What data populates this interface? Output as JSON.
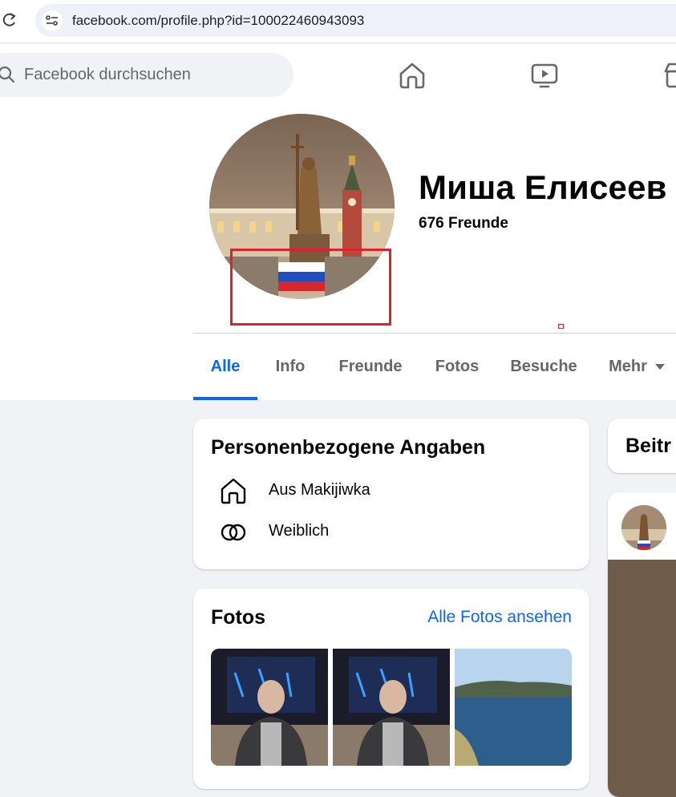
{
  "browser": {
    "url": "facebook.com/profile.php?id=100022460943093"
  },
  "nav": {
    "search_placeholder": "Facebook durchsuchen",
    "icons": [
      "home-icon",
      "watch-icon",
      "marketplace-icon"
    ]
  },
  "profile": {
    "name": "Миша Елисеев",
    "friends": "676 Freunde",
    "tabs": [
      {
        "label": "Alle",
        "active": true
      },
      {
        "label": "Info",
        "active": false
      },
      {
        "label": "Freunde",
        "active": false
      },
      {
        "label": "Fotos",
        "active": false
      },
      {
        "label": "Besuche",
        "active": false
      },
      {
        "label": "Mehr",
        "active": false
      }
    ]
  },
  "details": {
    "title": "Personenbezogene Angaben",
    "items": [
      {
        "icon": "home-icon",
        "text": "Aus Makijiwka"
      },
      {
        "icon": "gender-icon",
        "text": "Weiblich"
      }
    ]
  },
  "photos": {
    "title": "Fotos",
    "see_all": "Alle Fotos ansehen"
  },
  "posts": {
    "title": "Beitr"
  },
  "colors": {
    "accent": "#0866ff",
    "highlight": "#e0202a",
    "background": "#f0f2f5"
  }
}
